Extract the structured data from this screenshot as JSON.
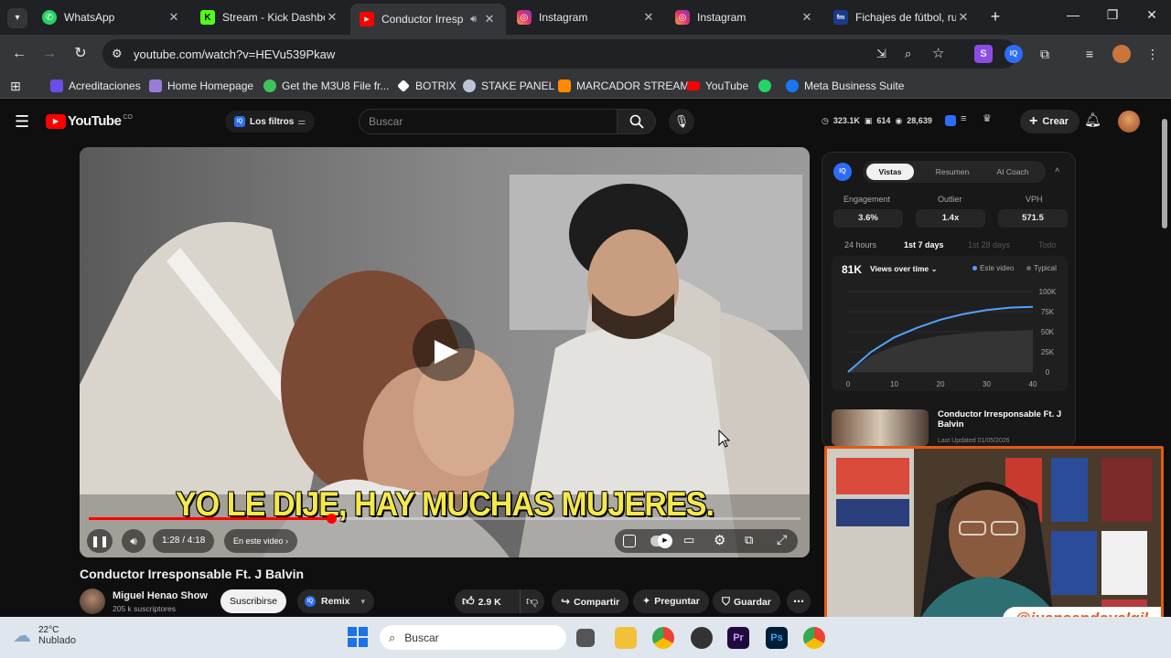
{
  "tabs": [
    {
      "label": "WhatsApp",
      "icon": "whatsapp-icon",
      "color": "#25d366"
    },
    {
      "label": "Stream - Kick Dashbo",
      "icon": "kick-icon",
      "color": "#53fc18"
    },
    {
      "label": "Conductor Irresp",
      "icon": "youtube-icon",
      "color": "#ff0000"
    },
    {
      "label": "Instagram",
      "icon": "instagram-icon",
      "color": "#e1306c"
    },
    {
      "label": "Instagram",
      "icon": "instagram-icon",
      "color": "#e1306c"
    },
    {
      "label": "Fichajes de fútbol, ru",
      "icon": "fm-icon",
      "color": "#1a3a8a"
    }
  ],
  "address": "youtube.com/watch?v=HEVu539Pkaw",
  "bookmarks": [
    {
      "label": "Acreditaciones",
      "color": "#6c4de6"
    },
    {
      "label": "Home Homepage",
      "color": "#9a7dd8"
    },
    {
      "label": "Get the M3U8 File fr...",
      "color": "#3ec45a"
    },
    {
      "label": "BOTRIX",
      "color": "#ffffff"
    },
    {
      "label": "STAKE PANEL",
      "color": "#bfc5d4"
    },
    {
      "label": "MARCADOR STREAM",
      "color": "#ff8a00"
    },
    {
      "label": "YouTube",
      "color": "#ff0000"
    },
    {
      "label": "",
      "color": "#25d366"
    },
    {
      "label": "Meta Business Suite",
      "color": "#1877f2"
    }
  ],
  "yt": {
    "logo_text": "YouTube",
    "country": "CO",
    "filters_label": "Los filtros",
    "search_placeholder": "Buscar",
    "stats": [
      "323.1K",
      "614",
      "28,639"
    ],
    "create_label": "Crear"
  },
  "video": {
    "caption": "YO LE DIJE, HAY MUCHAS MUJERES.",
    "time": "1:28 / 4:18",
    "chapter": "En este video",
    "progress": 0.34,
    "title": "Conductor Irresponsable Ft. J Balvin",
    "channel": "Miguel Henao Show",
    "subs": "205 k suscriptores",
    "subscribe": "Suscribirse",
    "remix": "Remix",
    "likes": "2.9 K",
    "share": "Compartir",
    "ask": "Preguntar",
    "save": "Guardar"
  },
  "iq": {
    "tabs": [
      "Vistas",
      "Resumen",
      "AI Coach"
    ],
    "metrics": [
      {
        "label": "Engagement",
        "value": "3.6%"
      },
      {
        "label": "Outlier",
        "value": "1.4x"
      },
      {
        "label": "VPH",
        "value": "571.5"
      }
    ],
    "ranges": [
      "24 hours",
      "1st 7 days",
      "1st 28 days",
      "Todo"
    ],
    "views_total": "81K",
    "views_dropdown": "Views over time",
    "legend_this": "Este video",
    "legend_typical": "Typical",
    "suggested_title": "Conductor Irresponsable Ft. J Balvin",
    "suggested_meta": "Last Updated 01/05/2026"
  },
  "chart_data": {
    "type": "line",
    "title": "Views over time",
    "x": [
      0,
      5,
      10,
      15,
      20,
      25,
      30,
      35,
      40
    ],
    "series": [
      {
        "name": "Este video",
        "values": [
          0,
          25000,
          43000,
          55000,
          65000,
          72000,
          77000,
          80000,
          81000
        ]
      },
      {
        "name": "Typical",
        "values": [
          0,
          20000,
          32000,
          40000,
          45000,
          48000,
          50000,
          51000,
          52000
        ]
      }
    ],
    "xticks": [
      "0",
      "10",
      "20",
      "30",
      "40"
    ],
    "yticks": [
      "100K",
      "75K",
      "50K",
      "25K",
      "0"
    ],
    "xlim": [
      0,
      40
    ],
    "ylim": [
      0,
      100000
    ]
  },
  "overlay": {
    "handle": "@juansandovalgil"
  },
  "taskbar": {
    "temp": "22°C",
    "weather": "Nublado",
    "search": "Buscar"
  }
}
